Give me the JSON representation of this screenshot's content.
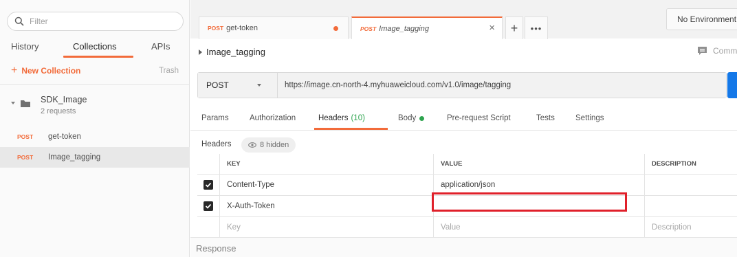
{
  "sidebar": {
    "filter_placeholder": "Filter",
    "tabs": [
      {
        "label": "History"
      },
      {
        "label": "Collections",
        "active": true
      },
      {
        "label": "APIs"
      }
    ],
    "new_collection": "New Collection",
    "trash": "Trash",
    "collection": {
      "name": "SDK_Image",
      "count": "2 requests"
    },
    "requests": [
      {
        "method": "POST",
        "name": "get-token"
      },
      {
        "method": "POST",
        "name": "Image_tagging",
        "selected": true
      }
    ]
  },
  "tabs": [
    {
      "method": "POST",
      "name": "get-token",
      "unsaved": true
    },
    {
      "method": "POST",
      "name": "Image_tagging",
      "active": true
    }
  ],
  "environment": "No Environment",
  "request": {
    "title": "Image_tagging",
    "comments": "Comments",
    "method": "POST",
    "url": "https://image.cn-north-4.myhuaweicloud.com/v1.0/image/tagging"
  },
  "request_tabs": [
    {
      "label": "Params"
    },
    {
      "label": "Authorization"
    },
    {
      "label": "Headers",
      "count": "(10)",
      "active": true
    },
    {
      "label": "Body"
    },
    {
      "label": "Pre-request Script"
    },
    {
      "label": "Tests"
    },
    {
      "label": "Settings"
    }
  ],
  "headers": {
    "label": "Headers",
    "hidden": "8 hidden",
    "columns": {
      "key": "KEY",
      "value": "VALUE",
      "description": "DESCRIPTION"
    },
    "rows": [
      {
        "key": "Content-Type",
        "value": "application/json",
        "description": "",
        "checked": true
      },
      {
        "key": "X-Auth-Token",
        "value": "",
        "description": "",
        "checked": true
      }
    ],
    "placeholders": {
      "key": "Key",
      "value": "Value",
      "description": "Description"
    }
  },
  "response": "Response",
  "colors": {
    "accent": "#f26b3a",
    "highlight": "#e0202a",
    "send": "#1478e8",
    "green": "#2ea44f"
  }
}
